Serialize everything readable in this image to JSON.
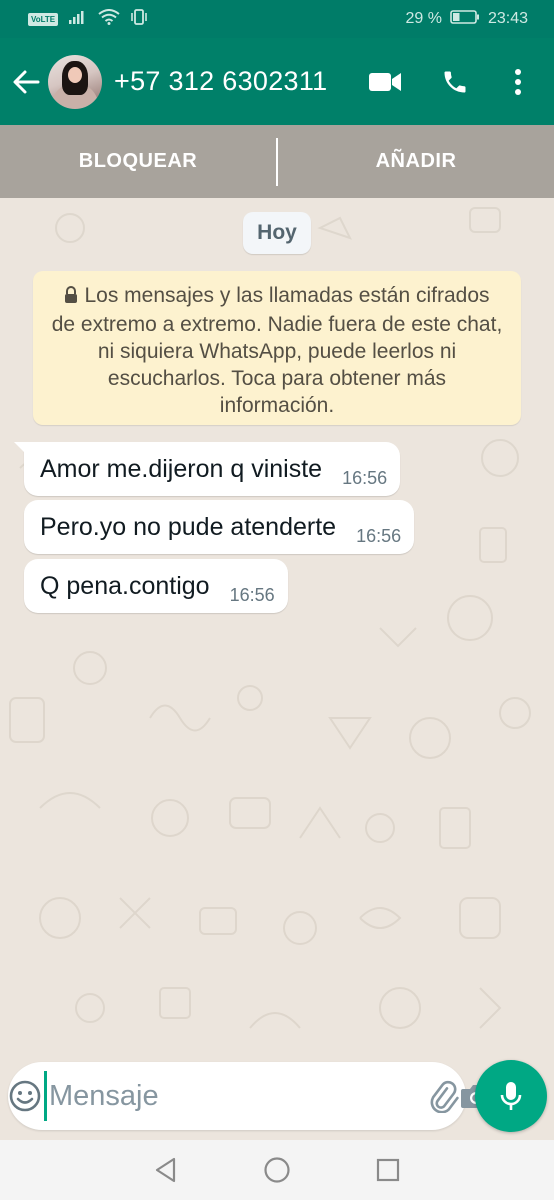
{
  "status_bar": {
    "volte": "VoLTE",
    "battery": "29 %",
    "time": "23:43"
  },
  "header": {
    "contact": "+57 312 6302311",
    "icons": [
      "back-arrow-icon",
      "video-call-icon",
      "phone-icon",
      "more-vert-icon"
    ]
  },
  "actions": {
    "block": "BLOQUEAR",
    "add": "AÑADIR"
  },
  "chat": {
    "date_chip": "Hoy",
    "notice": "Los mensajes y las llamadas están cifrados de extremo a extremo. Nadie fuera de este chat, ni siquiera WhatsApp, puede leerlos ni escucharlos. Toca para obtener más información.",
    "messages": [
      {
        "text": "Amor me.dijeron q viniste",
        "time": "16:56"
      },
      {
        "text": "Pero.yo no pude atenderte",
        "time": "16:56"
      },
      {
        "text": "Q pena.contigo",
        "time": "16:56"
      }
    ]
  },
  "composer": {
    "placeholder": "Mensaje"
  },
  "colors": {
    "header": "#008069",
    "status_bar": "#007c68",
    "accent": "#00a884",
    "chat_bg": "#ece5dd",
    "notice_bg": "#fdf2cf",
    "block_bar": "#a8a39c"
  }
}
